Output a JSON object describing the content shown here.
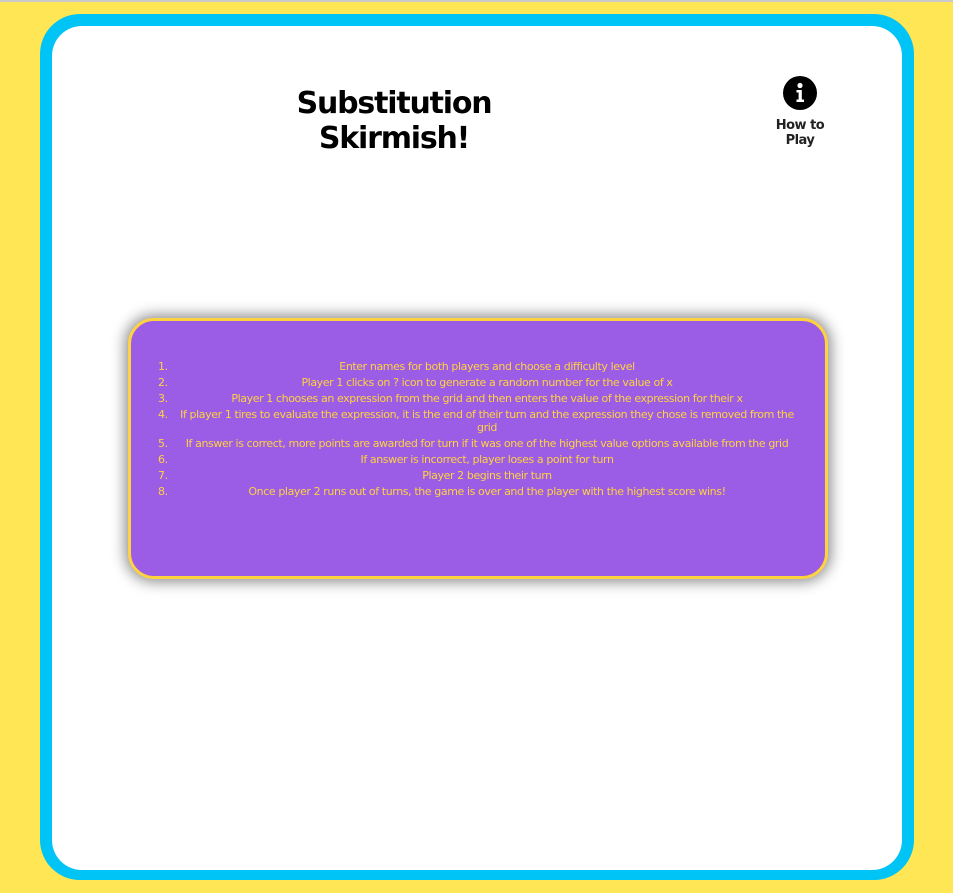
{
  "game": {
    "title": "Substitution Skirmish!"
  },
  "help": {
    "icon": "info-icon",
    "label": "How to Play"
  },
  "colors": {
    "background": "#ffe654",
    "frame": "#00c4f5",
    "panel": "#9b5de5",
    "panel_border": "#ffd23f",
    "rule_text": "#ffd23f"
  },
  "rules": [
    {
      "num": "1.",
      "text": "Enter names for both players and choose a difficulty level"
    },
    {
      "num": "2.",
      "text": "Player 1 clicks on ? icon to generate a random number for the value of x"
    },
    {
      "num": "3.",
      "text": "Player 1 chooses an expression from the grid and then enters the value of the expression for their x"
    },
    {
      "num": "4.",
      "text": "If player 1 tires to evaluate the expression, it is the end of their turn and the expression they chose is removed from the grid"
    },
    {
      "num": "5.",
      "text": "If answer is correct, more points are awarded for turn if it was one of the highest value options available from the grid"
    },
    {
      "num": "6.",
      "text": "If answer is incorrect, player loses a point for turn"
    },
    {
      "num": "7.",
      "text": "Player 2 begins their turn"
    },
    {
      "num": "8.",
      "text": "Once player 2 runs out of turns, the game is over and the player with the highest score wins!"
    }
  ]
}
